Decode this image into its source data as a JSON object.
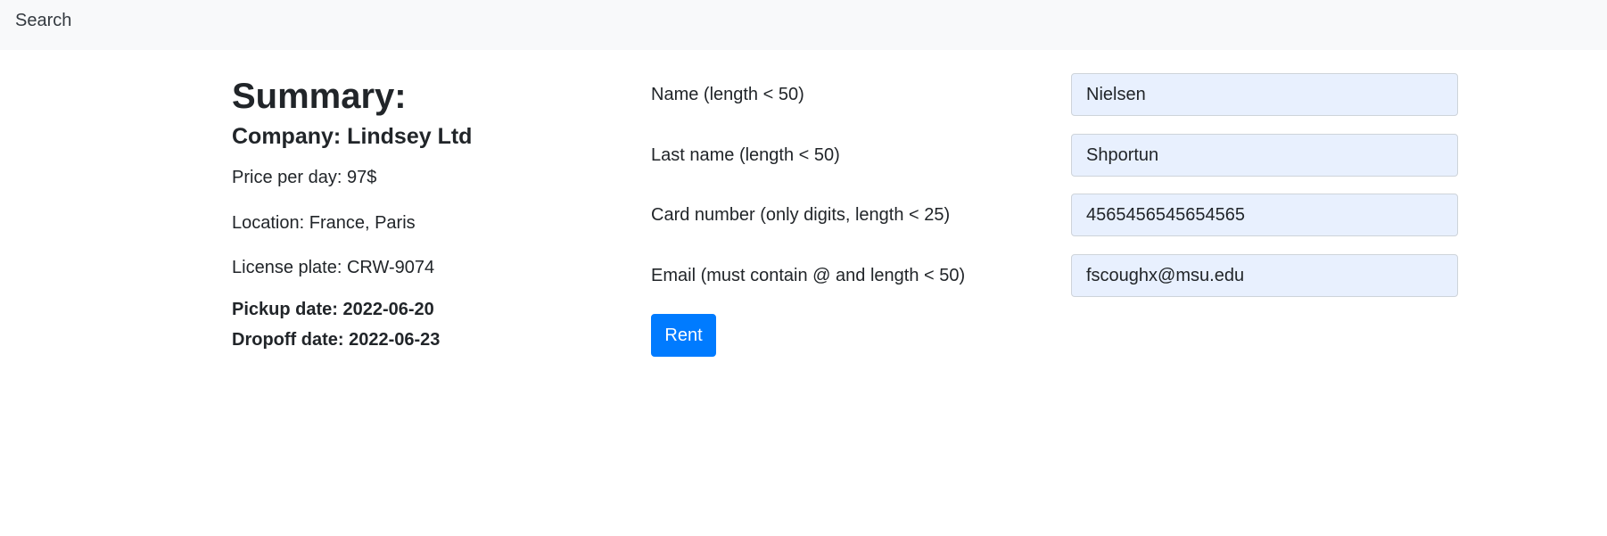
{
  "navbar": {
    "search_label": "Search"
  },
  "summary": {
    "title": "Summary:",
    "company": "Company: Lindsey Ltd",
    "price": "Price per day: 97$",
    "location": "Location: France, Paris",
    "license_plate": "License plate: CRW-9074",
    "pickup_date": "Pickup date: 2022-06-20",
    "dropoff_date": "Dropoff date: 2022-06-23"
  },
  "form": {
    "fields": [
      {
        "label": "Name (length < 50)",
        "value": "Nielsen"
      },
      {
        "label": "Last name (length < 50)",
        "value": "Shportun"
      },
      {
        "label": "Card number (only digits, length < 25)",
        "value": "4565456545654565"
      },
      {
        "label": "Email (must contain @ and length < 50)",
        "value": "fscoughx@msu.edu"
      }
    ],
    "submit_label": "Rent"
  },
  "colors": {
    "navbar_bg": "#f8f9fa",
    "input_bg": "#e8f0fe",
    "primary": "#007bff"
  }
}
